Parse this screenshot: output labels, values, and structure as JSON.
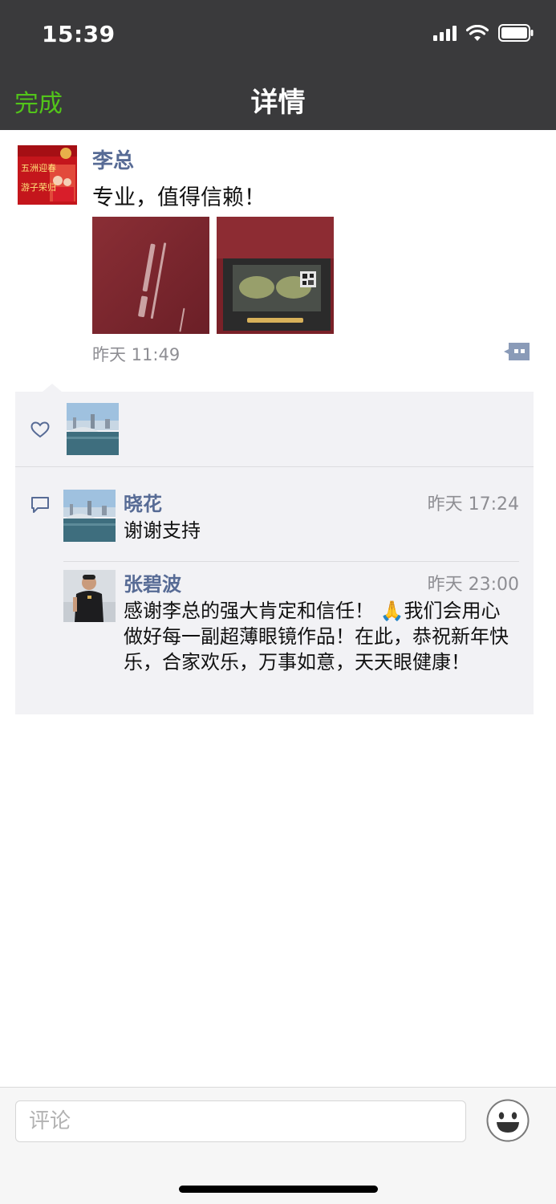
{
  "status_bar": {
    "time": "15:39"
  },
  "nav": {
    "done_label": "完成",
    "title": "详情"
  },
  "post": {
    "author": "李总",
    "text": "专业，值得信赖！",
    "time": "昨天 11:49",
    "avatar_text": [
      "五洲迎春",
      "游子荣归"
    ],
    "photos": [
      "photo-1",
      "photo-2"
    ]
  },
  "likes": {
    "count_avatars": 1
  },
  "comments": [
    {
      "name": "晓花",
      "time": "昨天 17:24",
      "text": "谢谢支持"
    },
    {
      "name": "张碧波",
      "time": "昨天 23:00",
      "text": "感谢李总的强大肯定和信任！ 🙏我们会用心做好每一副超薄眼镜作品！在此，恭祝新年快乐，合家欢乐，万事如意，天天眼健康！"
    }
  ],
  "input": {
    "placeholder": "评论"
  },
  "colors": {
    "accent_green": "#52c41a",
    "link_blue": "#576b95",
    "header_bg": "#3a3a3c",
    "panel_bg": "#f2f2f5"
  }
}
